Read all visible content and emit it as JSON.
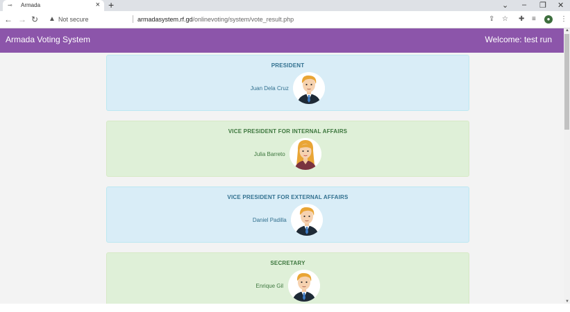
{
  "browser": {
    "tab_title": "Armada",
    "favicon": "slashed-circle-icon",
    "address": {
      "security_label": "Not secure",
      "domain": "armadasystem.rf.gd",
      "path": "/onlinevoting/system/vote_result.php"
    }
  },
  "navbar": {
    "brand": "Armada Voting System",
    "welcome": "Welcome: test run",
    "color": "#8c55aa"
  },
  "results": [
    {
      "position": "PRESIDENT",
      "candidate": "Juan Dela Cruz",
      "style": "info",
      "avatar": "male"
    },
    {
      "position": "VICE PRESIDENT FOR INTERNAL AFFAIRS",
      "candidate": "Julia Barreto",
      "style": "success",
      "avatar": "female"
    },
    {
      "position": "VICE PRESIDENT FOR EXTERNAL AFFAIRS",
      "candidate": "Daniel Padilla",
      "style": "info",
      "avatar": "male"
    },
    {
      "position": "SECRETARY",
      "candidate": "Enrique Gil",
      "style": "success",
      "avatar": "male"
    }
  ]
}
